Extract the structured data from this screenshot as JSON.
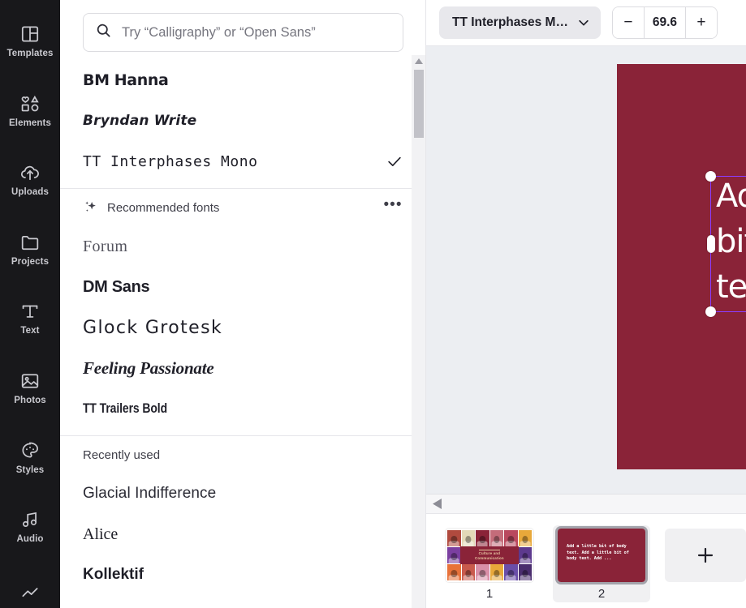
{
  "rail": {
    "items": [
      {
        "label": "Templates",
        "icon": "templates-icon"
      },
      {
        "label": "Elements",
        "icon": "elements-icon"
      },
      {
        "label": "Uploads",
        "icon": "uploads-icon"
      },
      {
        "label": "Projects",
        "icon": "projects-icon"
      },
      {
        "label": "Text",
        "icon": "text-icon"
      },
      {
        "label": "Photos",
        "icon": "photos-icon"
      },
      {
        "label": "Styles",
        "icon": "styles-icon"
      },
      {
        "label": "Audio",
        "icon": "audio-icon"
      }
    ]
  },
  "search": {
    "placeholder": "Try “Calligraphy” or “Open Sans”",
    "value": "",
    "icon": "search-icon"
  },
  "font_list": {
    "top_fonts": [
      {
        "name": "BM Hanna",
        "selected": false
      },
      {
        "name": "Bryndan Write",
        "selected": false
      },
      {
        "name": "TT Interphases Mono",
        "selected": true
      }
    ],
    "recommended": {
      "title": "Recommended fonts",
      "icon": "sparkle-icon",
      "more_label": "•••",
      "fonts": [
        {
          "name": "Forum"
        },
        {
          "name": "DM Sans"
        },
        {
          "name": "Glock Grotesk"
        },
        {
          "name": "Feeling Passionate"
        },
        {
          "name": "TT Trailers Bold"
        }
      ]
    },
    "recently_used": {
      "title": "Recently used",
      "fonts": [
        {
          "name": "Glacial Indifference"
        },
        {
          "name": "Alice"
        },
        {
          "name": "Kollektif"
        }
      ]
    },
    "check_icon": "check-icon"
  },
  "toolbar": {
    "font_name": "TT Interphases M…",
    "font_dropdown_icon": "chevron-down-icon",
    "decrease_label": "−",
    "increase_label": "+",
    "font_size": "69.6"
  },
  "canvas": {
    "background_color": "#8a2338",
    "selection_color": "#8b3dff",
    "text": "Add a little\nbit of body\ntext. Add",
    "text_color": "#ffffff"
  },
  "page_strip": {
    "collapse_icon": "collapse-left-icon",
    "add_page_icon": "plus-icon",
    "pages": [
      {
        "number": "1",
        "selected": false,
        "title_line1": "Culture and",
        "title_line2": "Communication"
      },
      {
        "number": "2",
        "selected": true,
        "body_text": "Add a little bit of body text. Add a little bit of body text. Add ..."
      }
    ]
  }
}
